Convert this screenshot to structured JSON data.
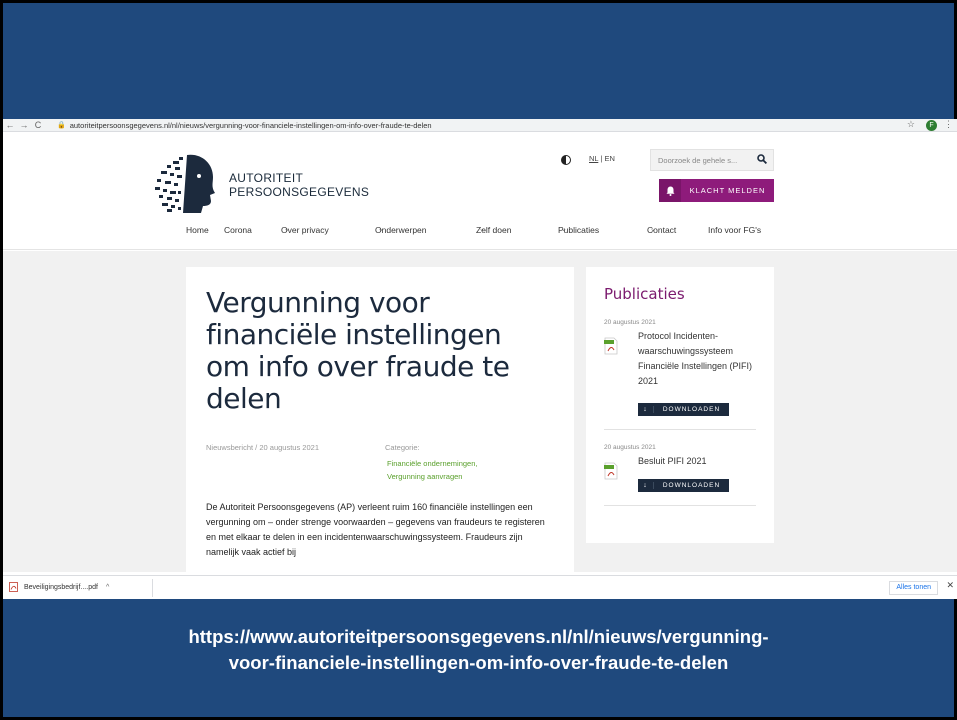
{
  "browser": {
    "url": "autoriteitpersoonsgegevens.nl/nl/nieuws/vergunning-voor-financiele-instellingen-om-info-over-fraude-te-delen",
    "profile_initial": "F"
  },
  "header": {
    "logo_line1": "AUTORITEIT",
    "logo_line2": "PERSOONSGEGEVENS",
    "lang_nl": "NL",
    "lang_sep": "|",
    "lang_en": "EN",
    "search_placeholder": "Doorzoek de gehele s...",
    "report_button": "KLACHT MELDEN"
  },
  "nav": {
    "items": [
      "Home",
      "Corona",
      "Over privacy",
      "Onderwerpen",
      "Zelf doen",
      "Publicaties",
      "Contact",
      "Info voor FG's"
    ]
  },
  "article": {
    "title": "Vergunning voor financiële instellingen om info over fraude te delen",
    "meta": "Nieuwsbericht / 20 augustus 2021",
    "category_label": "Categorie:",
    "categories": [
      "Financiële ondernemingen,",
      "Vergunning aanvragen"
    ],
    "body": "De Autoriteit Persoonsgegevens (AP) verleent ruim 160 financiële instellingen een vergunning om – onder strenge voorwaarden – gegevens van fraudeurs te registeren en met elkaar te delen in een incidentenwaarschuwingssysteem. Fraudeurs zijn namelijk vaak actief bij"
  },
  "sidebar": {
    "title": "Publicaties",
    "items": [
      {
        "date": "20 augustus 2021",
        "title": "Protocol Incidenten-waarschuwingssysteem Financiële Instellingen (PIFI) 2021",
        "button": "DOWNLOADEN"
      },
      {
        "date": "20 augustus 2021",
        "title": "Besluit PIFI 2021",
        "button": "DOWNLOADEN"
      }
    ]
  },
  "downloads": {
    "file": "Beveiligingsbedrijf....pdf",
    "show_all": "Alles tonen"
  },
  "caption": {
    "line1": "https://www.autoriteitpersoonsgegevens.nl/nl/nieuws/vergunning-",
    "line2": "voor-financiele-instellingen-om-info-over-fraude-te-delen"
  }
}
